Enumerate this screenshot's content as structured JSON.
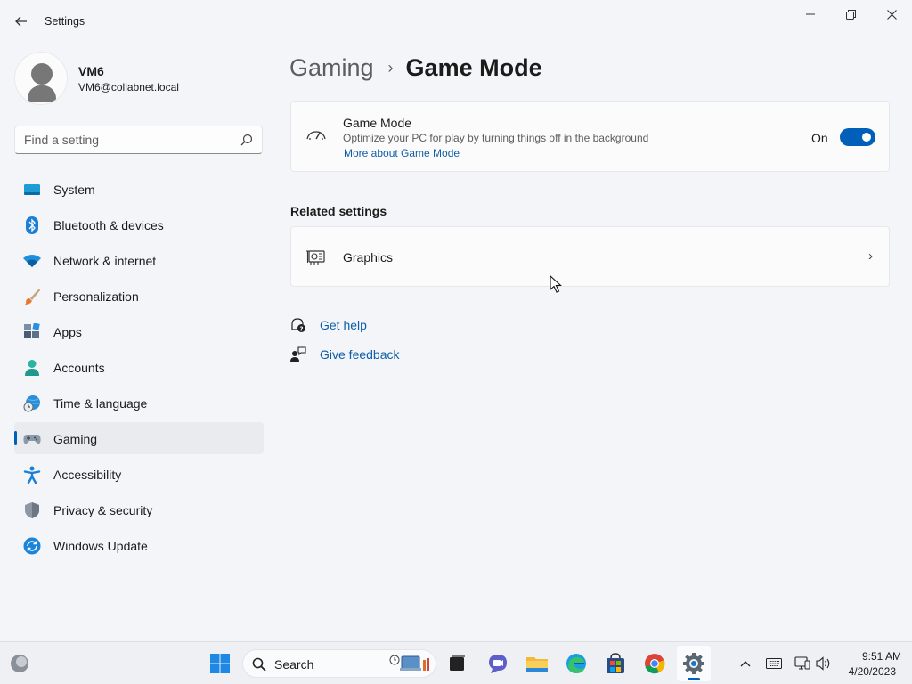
{
  "window": {
    "title": "Settings",
    "back_icon": "arrow-left-icon",
    "minimize_icon": "minimize-icon",
    "maximize_icon": "restore-icon",
    "close_icon": "close-icon"
  },
  "profile": {
    "name": "VM6",
    "email": "VM6@collabnet.local",
    "avatar_icon": "user-avatar-icon"
  },
  "search": {
    "placeholder": "Find a setting",
    "value": "",
    "icon": "search-icon"
  },
  "sidebar": {
    "items": [
      {
        "label": "System",
        "icon": "monitor-icon",
        "selected": false
      },
      {
        "label": "Bluetooth & devices",
        "icon": "bluetooth-icon",
        "selected": false
      },
      {
        "label": "Network & internet",
        "icon": "wifi-icon",
        "selected": false
      },
      {
        "label": "Personalization",
        "icon": "brush-icon",
        "selected": false
      },
      {
        "label": "Apps",
        "icon": "apps-icon",
        "selected": false
      },
      {
        "label": "Accounts",
        "icon": "person-icon",
        "selected": false
      },
      {
        "label": "Time & language",
        "icon": "globe-clock-icon",
        "selected": false
      },
      {
        "label": "Gaming",
        "icon": "gamepad-icon",
        "selected": true
      },
      {
        "label": "Accessibility",
        "icon": "accessibility-icon",
        "selected": false
      },
      {
        "label": "Privacy & security",
        "icon": "shield-icon",
        "selected": false
      },
      {
        "label": "Windows Update",
        "icon": "update-icon",
        "selected": false
      }
    ]
  },
  "breadcrumb": {
    "parent": "Gaming",
    "separator": "›",
    "current": "Game Mode"
  },
  "game_mode": {
    "title": "Game Mode",
    "description": "Optimize your PC for play by turning things off in the background",
    "link": "More about Game Mode",
    "toggle_state_label": "On",
    "toggle_on": true,
    "icon": "game-mode-gauge-icon"
  },
  "related": {
    "heading": "Related settings",
    "graphics_label": "Graphics",
    "graphics_icon": "graphics-card-icon",
    "chevron": "›"
  },
  "help": {
    "get_help": "Get help",
    "get_help_icon": "help-chat-icon",
    "give_feedback": "Give feedback",
    "give_feedback_icon": "feedback-icon"
  },
  "taskbar": {
    "search_label": "Search",
    "time": "9:51 AM",
    "date": "4/20/2023",
    "apps": [
      "start-icon",
      "task-view-icon",
      "teams-chat-icon",
      "file-explorer-icon",
      "edge-icon",
      "store-icon",
      "chrome-icon",
      "settings-icon"
    ],
    "tray": [
      "chevron-up-icon",
      "keyboard-icon",
      "network-icon",
      "volume-icon"
    ]
  },
  "colors": {
    "accent": "#005fb8",
    "link": "#0f5ea8",
    "background": "#f3f5f8",
    "card": "#fbfbfb"
  }
}
